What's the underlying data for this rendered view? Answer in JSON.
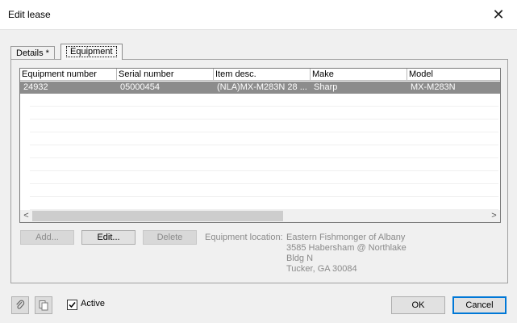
{
  "window": {
    "title": "Edit lease"
  },
  "tabs": [
    {
      "label": "Details *",
      "active": false
    },
    {
      "label": "Equipment",
      "active": true
    }
  ],
  "grid": {
    "columns": [
      "Equipment number",
      "Serial number",
      "Item desc.",
      "Make",
      "Model"
    ],
    "rows": [
      {
        "equipment_number": "24932",
        "serial_number": "05000454",
        "item_desc": "(NLA)MX-M283N 28 ...",
        "make": "Sharp",
        "model": "MX-M283N",
        "selected": true
      }
    ]
  },
  "buttons": {
    "add": "Add...",
    "edit": "Edit...",
    "delete": "Delete",
    "ok": "OK",
    "cancel": "Cancel"
  },
  "location": {
    "label": "Equipment location:",
    "lines": [
      "Eastern Fishmonger of Albany",
      "3585 Habersham @ Northlake",
      "Bldg N",
      "Tucker, GA 30084"
    ]
  },
  "footer": {
    "active_label": "Active",
    "active_checked": true
  },
  "icons": {
    "close": "close-icon",
    "attach": "paperclip-icon",
    "copy": "copy-icon",
    "scroll_left": "chevron-left-icon",
    "scroll_right": "chevron-right-icon"
  },
  "colors": {
    "selection": "#8c8c8c",
    "default_button_border": "#0078d7"
  }
}
